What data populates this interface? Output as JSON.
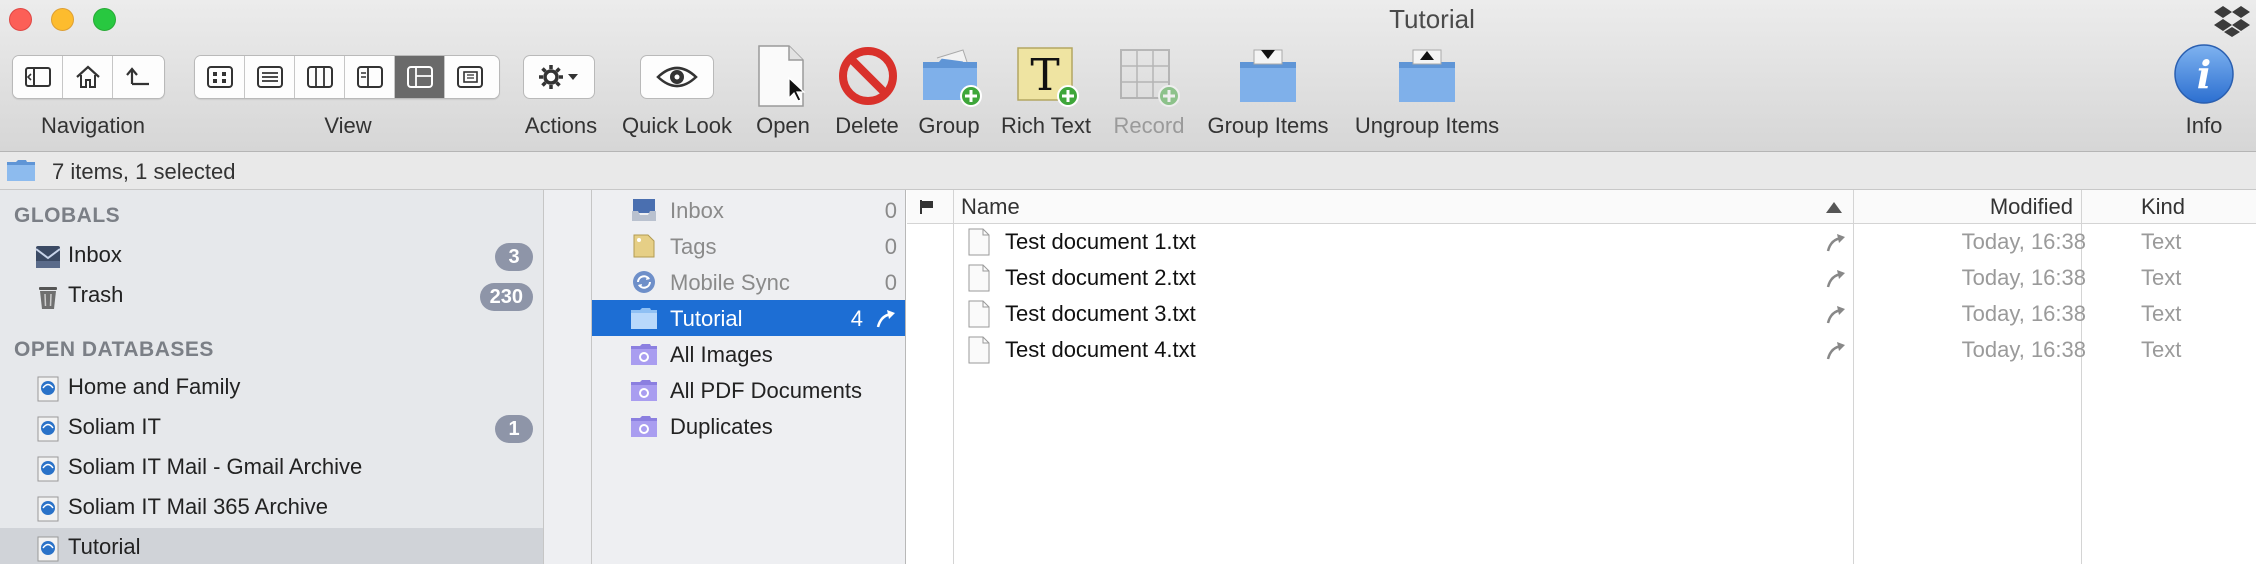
{
  "window": {
    "title": "Tutorial"
  },
  "toolbar": {
    "navigation_label": "Navigation",
    "view_label": "View",
    "actions_label": "Actions",
    "quicklook_label": "Quick Look",
    "open_label": "Open",
    "delete_label": "Delete",
    "group_label": "Group",
    "richtext_label": "Rich Text",
    "record_label": "Record",
    "groupitems_label": "Group Items",
    "ungroupitems_label": "Ungroup Items",
    "info_label": "Info"
  },
  "status": {
    "text": "7 items, 1 selected"
  },
  "sidebar": {
    "globals_header": "GLOBALS",
    "globals": [
      {
        "label": "Inbox",
        "badge": "3"
      },
      {
        "label": "Trash",
        "badge": "230"
      }
    ],
    "databases_header": "OPEN DATABASES",
    "databases": [
      {
        "label": "Home and Family",
        "badge": ""
      },
      {
        "label": "Soliam IT",
        "badge": "1"
      },
      {
        "label": "Soliam IT Mail - Gmail Archive",
        "badge": ""
      },
      {
        "label": "Soliam IT Mail 365 Archive",
        "badge": ""
      },
      {
        "label": "Tutorial",
        "badge": ""
      }
    ]
  },
  "groups": [
    {
      "label": "Inbox",
      "count": "0"
    },
    {
      "label": "Tags",
      "count": "0"
    },
    {
      "label": "Mobile Sync",
      "count": "0"
    },
    {
      "label": "Tutorial",
      "count": "4"
    },
    {
      "label": "All Images",
      "count": ""
    },
    {
      "label": "All PDF Documents",
      "count": ""
    },
    {
      "label": "Duplicates",
      "count": ""
    }
  ],
  "list": {
    "headers": {
      "name": "Name",
      "modified": "Modified",
      "kind": "Kind"
    },
    "rows": [
      {
        "name": "Test document 1.txt",
        "modified": "Today, 16:38",
        "kind": "Text"
      },
      {
        "name": "Test document 2.txt",
        "modified": "Today, 16:38",
        "kind": "Text"
      },
      {
        "name": "Test document 3.txt",
        "modified": "Today, 16:38",
        "kind": "Text"
      },
      {
        "name": "Test document 4.txt",
        "modified": "Today, 16:38",
        "kind": "Text"
      }
    ]
  },
  "colors": {
    "selection": "#1d6ed4",
    "badge": "#8e95a8",
    "delete_red": "#d9312b",
    "folder_blue": "#6ea4e0",
    "smart_group_purple": "#9b8fe8"
  }
}
